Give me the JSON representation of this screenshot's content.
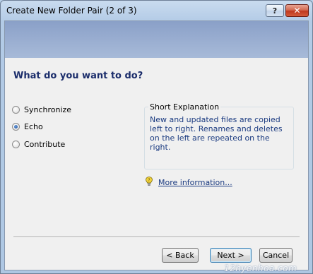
{
  "window": {
    "title": "Create New Folder Pair (2 of 3)",
    "help_label": "?",
    "close_label": "✕"
  },
  "main": {
    "heading": "What do you want to do?",
    "options": [
      {
        "label": "Synchronize",
        "selected": false
      },
      {
        "label": "Echo",
        "selected": true
      },
      {
        "label": "Contribute",
        "selected": false
      }
    ],
    "explanation": {
      "title": "Short Explanation",
      "text": "New and updated files are copied left to right. Renames and deletes on the left are repeated on the right."
    },
    "more_info": {
      "icon": "help-bulb-icon",
      "label": "More information..."
    }
  },
  "buttons": {
    "back": "< Back",
    "next": "Next >",
    "cancel": "Cancel"
  },
  "watermark": "12hyenhoa.com",
  "colors": {
    "heading": "#1b2d6b",
    "link": "#1a3a80",
    "banner": "#9cb0d2"
  }
}
